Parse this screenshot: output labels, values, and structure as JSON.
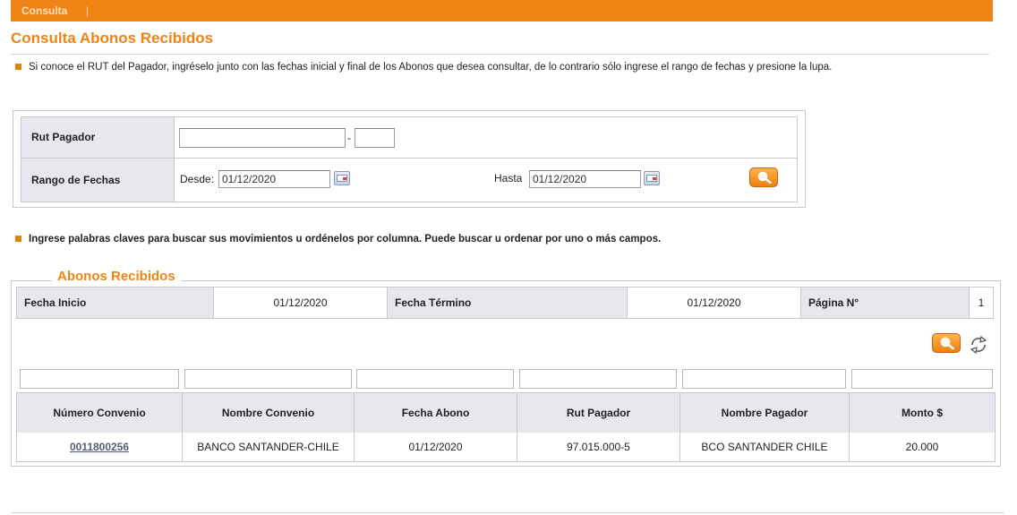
{
  "breadcrumb": {
    "item": "Consulta",
    "separator": "|"
  },
  "page_title": "Consulta Abonos Recibidos",
  "info_text": "Si conoce el RUT del Pagador, ingréselo junto con las fechas inicial y final de los Abonos que desea consultar, de lo contrario sólo ingrese el rango de fechas y presione la lupa.",
  "form": {
    "rut_label": "Rut Pagador",
    "rut_dash": "-",
    "rut_value": "",
    "rut_dv_value": "",
    "range_label": "Rango de Fechas",
    "desde_label": "Desde:",
    "desde_value": "01/12/2020",
    "hasta_label": "Hasta",
    "hasta_value": "01/12/2020"
  },
  "keywords_text": "Ingrese palabras claves para buscar sus movimientos u ordénelos por columna. Puede buscar u ordenar por uno o más campos.",
  "results": {
    "legend": "Abonos Recibidos",
    "fecha_inicio_label": "Fecha Inicio",
    "fecha_inicio_value": "01/12/2020",
    "fecha_termino_label": "Fecha Término",
    "fecha_termino_value": "01/12/2020",
    "pagina_label": "Página N°",
    "pagina_value": "1",
    "columns": [
      "Número Convenio",
      "Nombre Convenio",
      "Fecha Abono",
      "Rut Pagador",
      "Nombre Pagador",
      "Monto $"
    ],
    "rows": [
      [
        "0011800256",
        "BANCO SANTANDER-CHILE",
        "01/12/2020",
        "97.015.000-5",
        "BCO SANTANDER CHILE",
        "20.000"
      ]
    ]
  },
  "colors": {
    "accent": "#ef8414",
    "header_bg": "#e7e7ee",
    "border": "#c8c8c8"
  },
  "icons": [
    "search-icon",
    "calendar-icon",
    "refresh-icon"
  ]
}
